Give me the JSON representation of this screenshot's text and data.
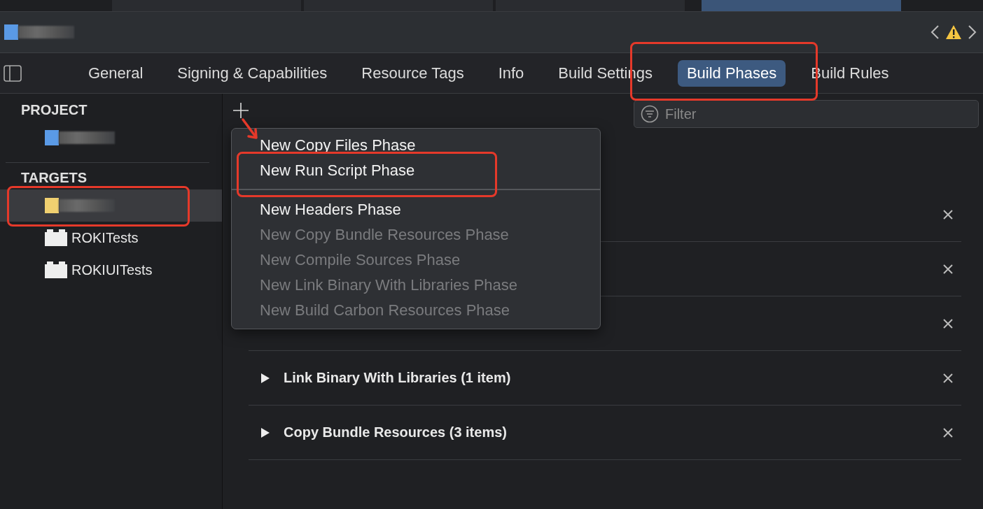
{
  "tab_strip": [
    {
      "selected": false
    },
    {
      "selected": false
    },
    {
      "selected": false
    },
    {
      "selected": true
    }
  ],
  "editor_tabs": [
    {
      "label": "General",
      "selected": false
    },
    {
      "label": "Signing & Capabilities",
      "selected": false
    },
    {
      "label": "Resource Tags",
      "selected": false
    },
    {
      "label": "Info",
      "selected": false
    },
    {
      "label": "Build Settings",
      "selected": false
    },
    {
      "label": "Build Phases",
      "selected": true
    },
    {
      "label": "Build Rules",
      "selected": false
    }
  ],
  "sidebar": {
    "sections": [
      {
        "title": "PROJECT",
        "items": [
          {
            "kind": "redacted",
            "color": "#5a9ae6",
            "selected": false
          }
        ]
      },
      {
        "title": "TARGETS",
        "items": [
          {
            "kind": "redacted",
            "color": "#f0d070",
            "selected": true
          },
          {
            "kind": "target",
            "label": "ROKITests",
            "selected": false
          },
          {
            "kind": "target",
            "label": "ROKIUITests",
            "selected": false
          }
        ]
      }
    ]
  },
  "filter": {
    "placeholder": "Filter"
  },
  "phases": [
    {
      "kind": "covered"
    },
    {
      "kind": "covered"
    },
    {
      "kind": "covered"
    },
    {
      "kind": "phase",
      "label": "Link Binary With Libraries (1 item)",
      "expanded": false
    },
    {
      "kind": "phase",
      "label": "Copy Bundle Resources (3 items)",
      "expanded": false
    }
  ],
  "add_menu": {
    "groups": [
      [
        {
          "label": "New Copy Files Phase",
          "disabled": false
        },
        {
          "label": "New Run Script Phase",
          "disabled": false
        }
      ],
      [
        {
          "label": "New Headers Phase",
          "disabled": false
        },
        {
          "label": "New Copy Bundle Resources Phase",
          "disabled": true
        },
        {
          "label": "New Compile Sources Phase",
          "disabled": true
        },
        {
          "label": "New Link Binary With Libraries Phase",
          "disabled": true
        },
        {
          "label": "New Build Carbon Resources Phase",
          "disabled": true
        }
      ]
    ]
  }
}
